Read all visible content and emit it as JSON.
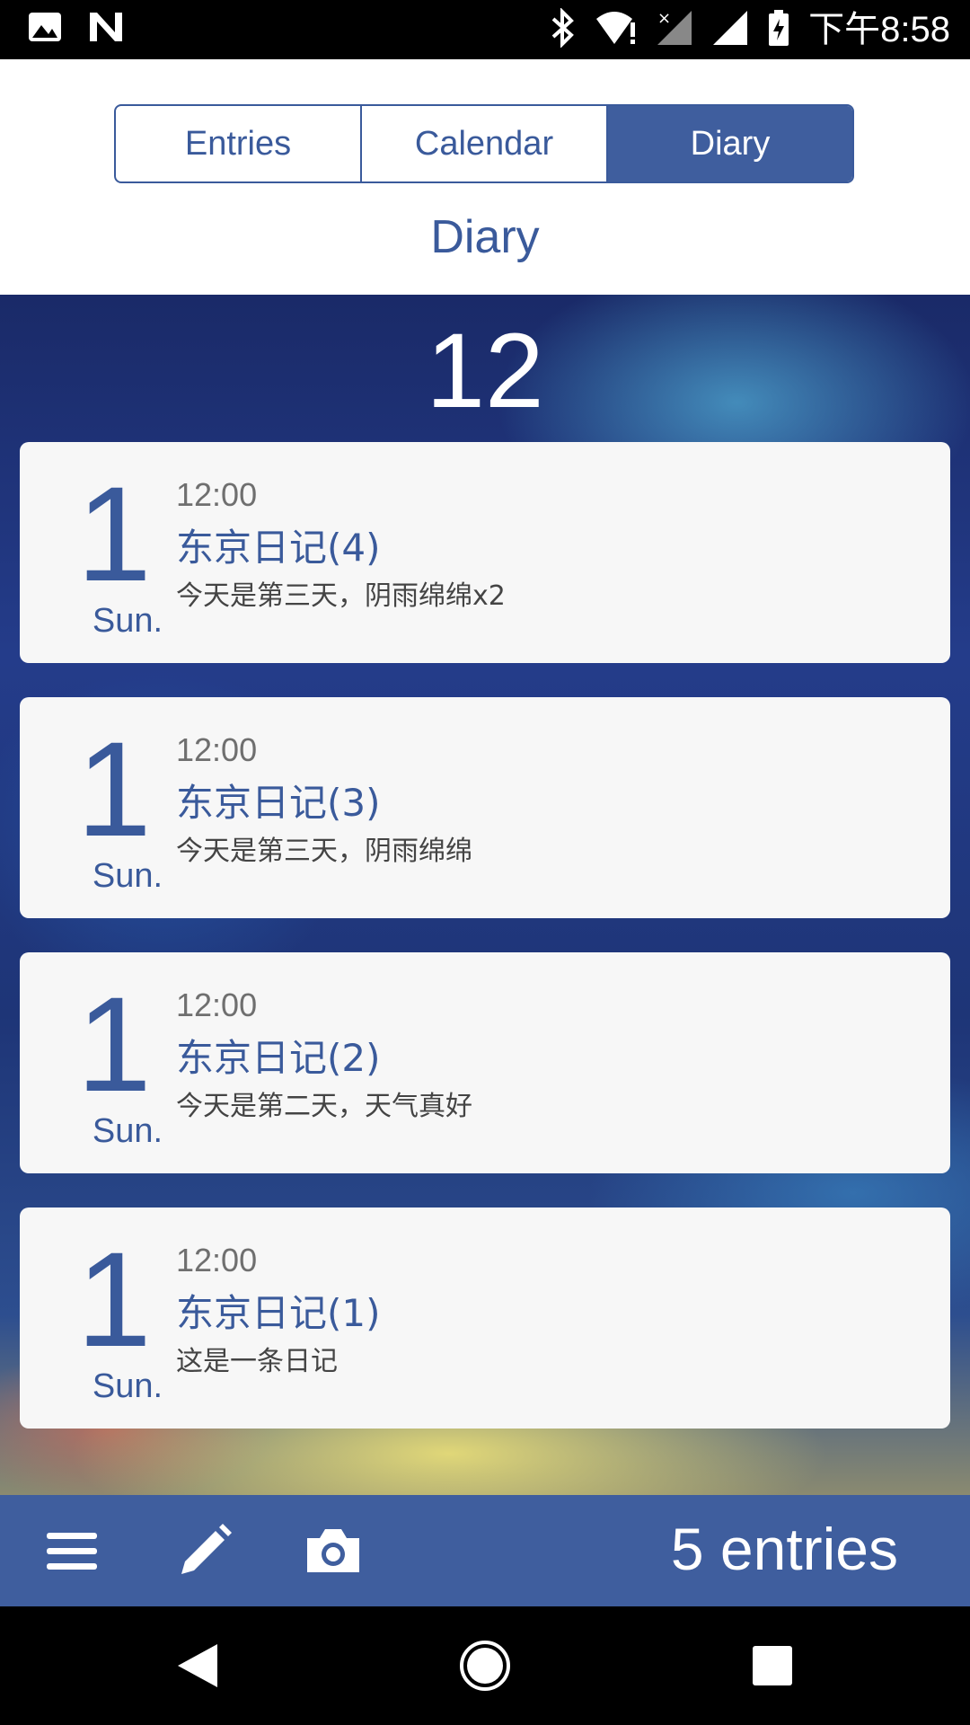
{
  "status_bar": {
    "time": "下午8:58",
    "icons": [
      "image-icon",
      "n-icon",
      "bluetooth-icon",
      "wifi-alert-icon",
      "no-signal-icon",
      "signal-icon",
      "battery-charging-icon"
    ]
  },
  "header": {
    "tabs": [
      {
        "label": "Entries",
        "active": false
      },
      {
        "label": "Calendar",
        "active": false
      },
      {
        "label": "Diary",
        "active": true
      }
    ],
    "title": "Diary"
  },
  "month": "12",
  "entries": [
    {
      "day": "1",
      "weekday": "Sun.",
      "time": "12:00",
      "title": "东京日记(4)",
      "summary": "今天是第三天，阴雨绵绵x2"
    },
    {
      "day": "1",
      "weekday": "Sun.",
      "time": "12:00",
      "title": "东京日记(3)",
      "summary": "今天是第三天，阴雨绵绵"
    },
    {
      "day": "1",
      "weekday": "Sun.",
      "time": "12:00",
      "title": "东京日记(2)",
      "summary": "今天是第二天，天气真好"
    },
    {
      "day": "1",
      "weekday": "Sun.",
      "time": "12:00",
      "title": "东京日记(1)",
      "summary": "这是一条日记"
    }
  ],
  "bottom_bar": {
    "icons": [
      "menu-icon",
      "pencil-icon",
      "camera-icon"
    ],
    "count_label": "5 entries"
  },
  "nav_bar": {
    "icons": [
      "back-icon",
      "home-icon",
      "recents-icon"
    ]
  },
  "colors": {
    "accent": "#3f5e9e",
    "text_accent": "#3a5a9b",
    "card_bg": "#f7f7f7"
  }
}
